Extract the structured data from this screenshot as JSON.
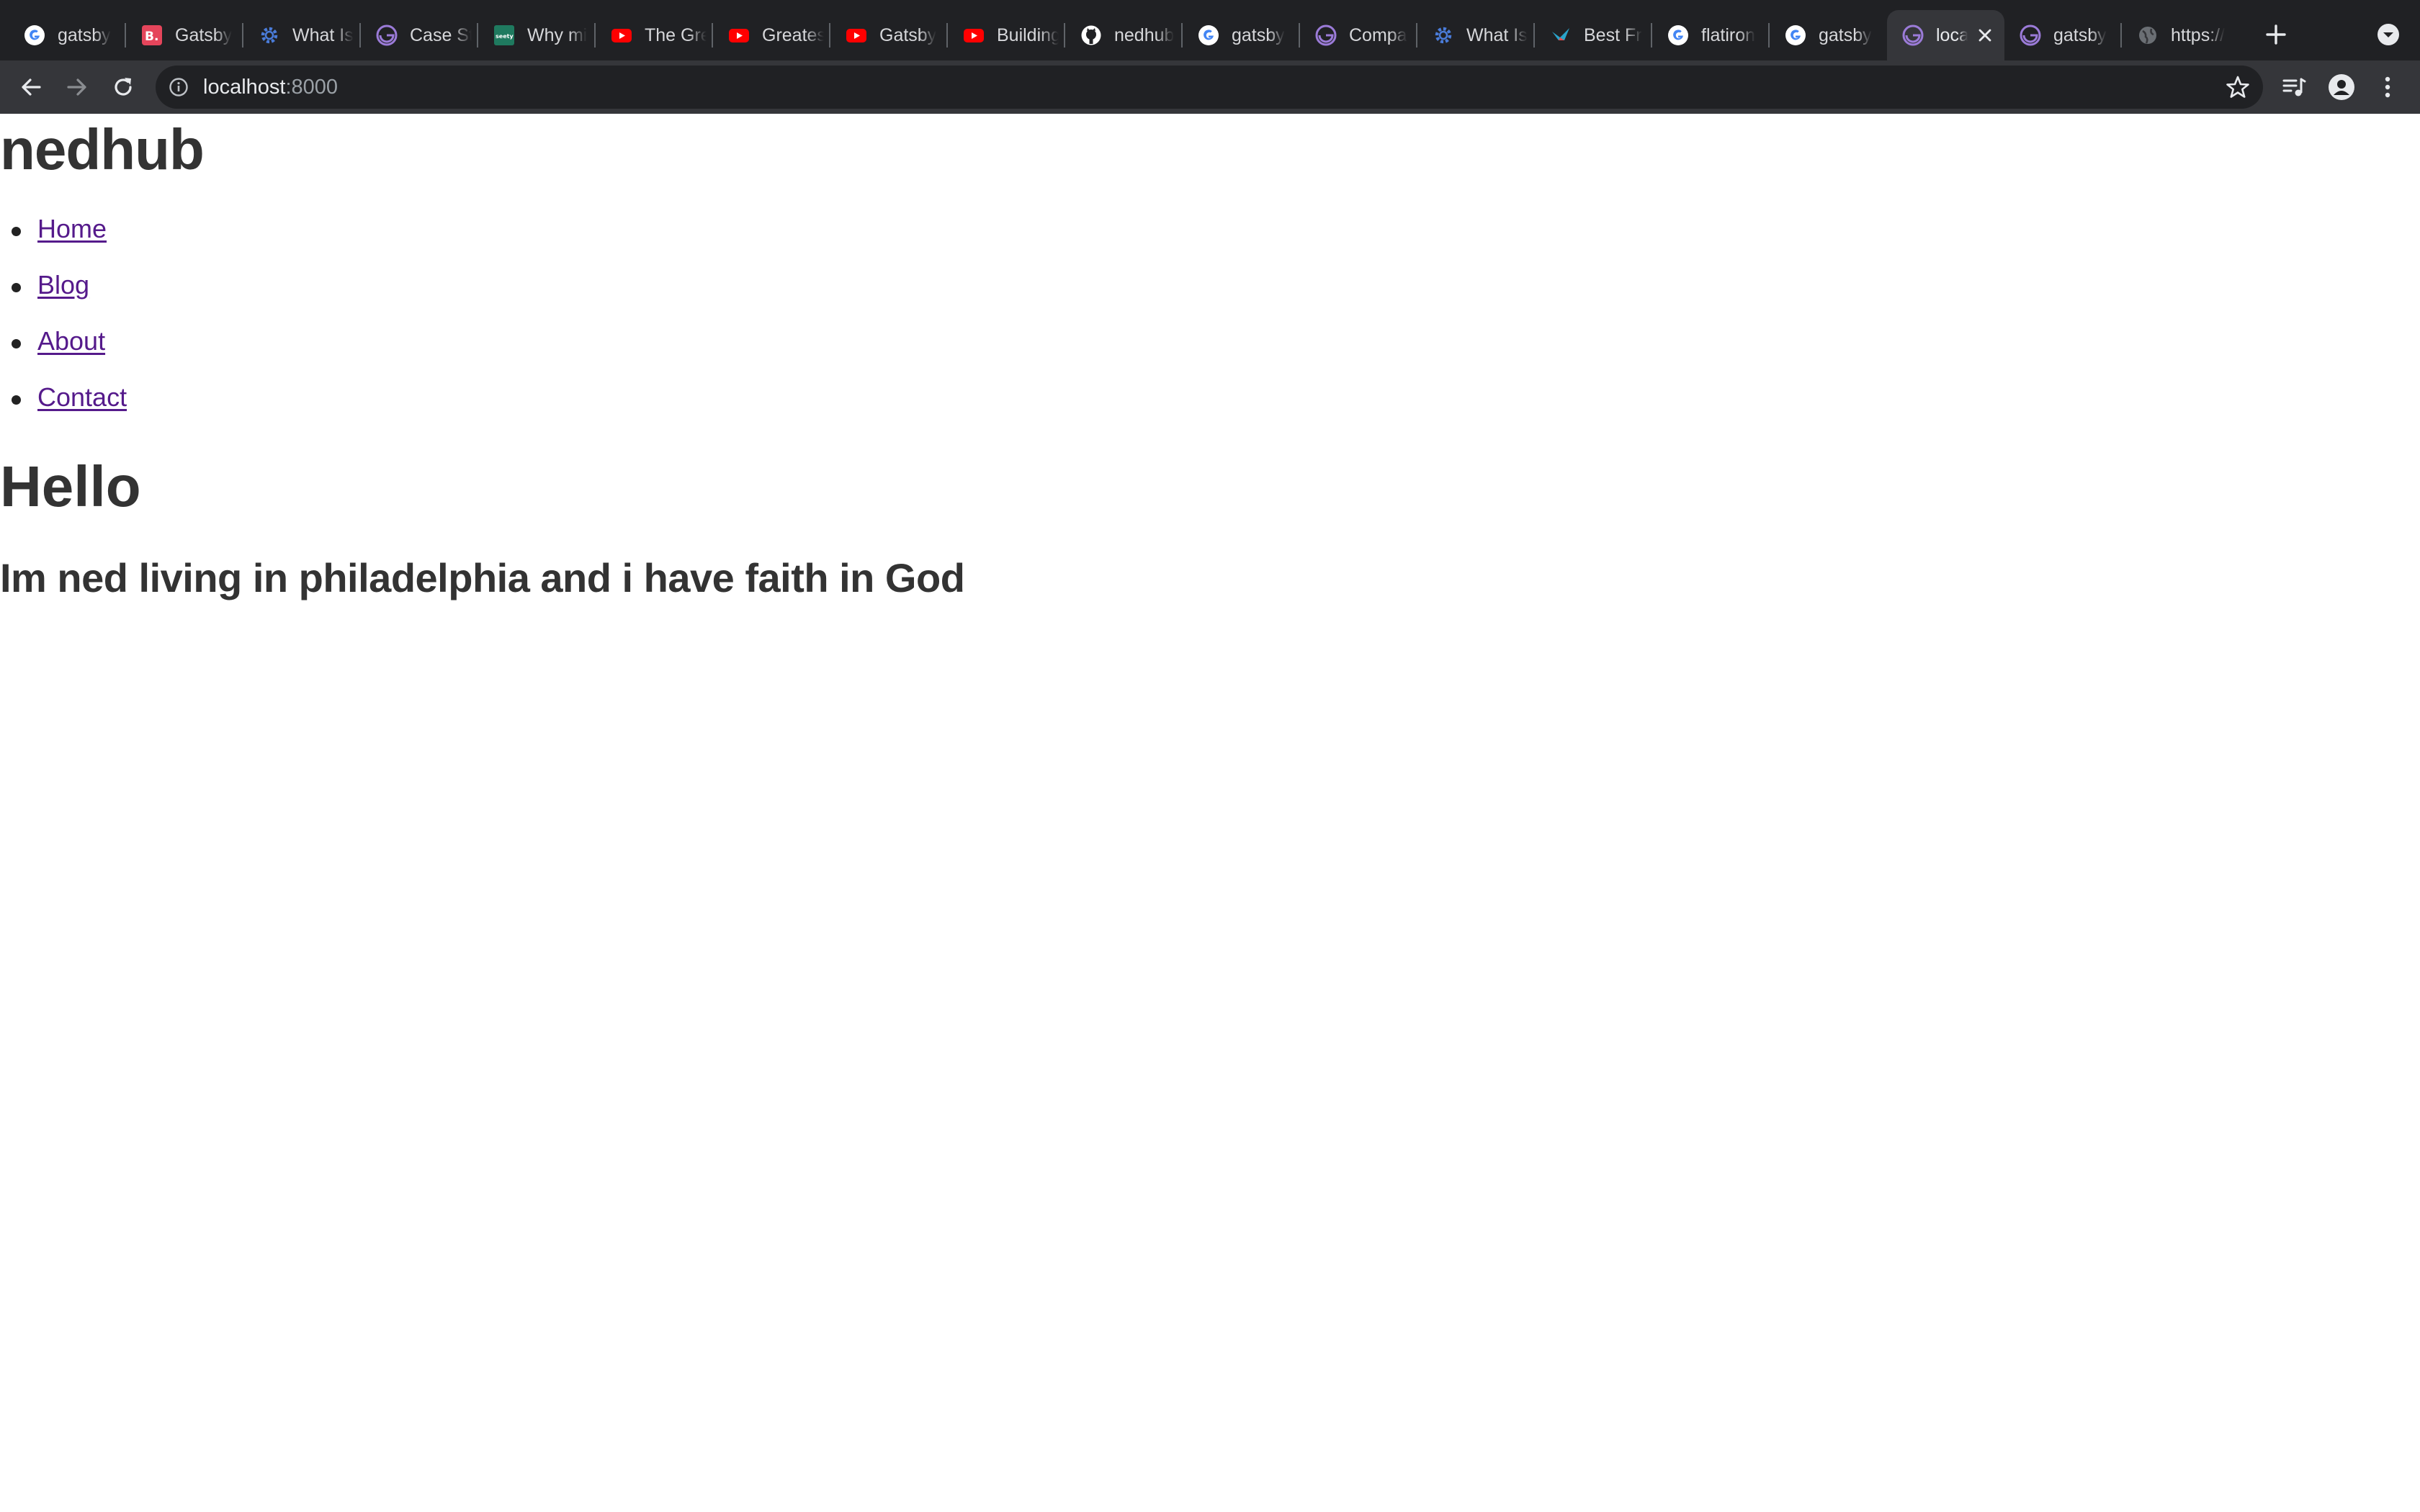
{
  "browser": {
    "tabs": [
      {
        "title": "gatsby",
        "icon": "google-icon"
      },
      {
        "title": "Gatsby",
        "icon": "b-logo-icon"
      },
      {
        "title": "What Is",
        "icon": "gear-icon"
      },
      {
        "title": "Case St",
        "icon": "gatsby-icon"
      },
      {
        "title": "Why mi",
        "icon": "seety-icon"
      },
      {
        "title": "The Gre",
        "icon": "youtube-icon"
      },
      {
        "title": "Greates",
        "icon": "youtube-icon"
      },
      {
        "title": "Gatsby",
        "icon": "youtube-icon"
      },
      {
        "title": "Building",
        "icon": "youtube-icon"
      },
      {
        "title": "nedhub",
        "icon": "github-icon"
      },
      {
        "title": "gatsby",
        "icon": "google-icon"
      },
      {
        "title": "Compa",
        "icon": "gatsby-icon"
      },
      {
        "title": "What Is",
        "icon": "gear-icon"
      },
      {
        "title": "Best Fr",
        "icon": "bird-icon"
      },
      {
        "title": "flatiron",
        "icon": "google-icon"
      },
      {
        "title": "gatsby",
        "icon": "google-icon"
      },
      {
        "title": "loca",
        "icon": "gatsby-icon",
        "active": true
      },
      {
        "title": "gatsby",
        "icon": "gatsby-icon"
      },
      {
        "title": "https://",
        "icon": "globe-icon"
      }
    ],
    "address": {
      "host": "localhost",
      "port": ":8000"
    }
  },
  "site": {
    "title": "nedhub",
    "nav": [
      {
        "label": "Home"
      },
      {
        "label": "Blog"
      },
      {
        "label": "About"
      },
      {
        "label": "Contact"
      }
    ],
    "heading": "Hello",
    "tagline": "Im ned living in philadelphia and i have faith in God"
  },
  "colors": {
    "text": "#333333",
    "visited_link": "#551a8b",
    "tabstrip": "#202124",
    "toolbar": "#35363a"
  }
}
